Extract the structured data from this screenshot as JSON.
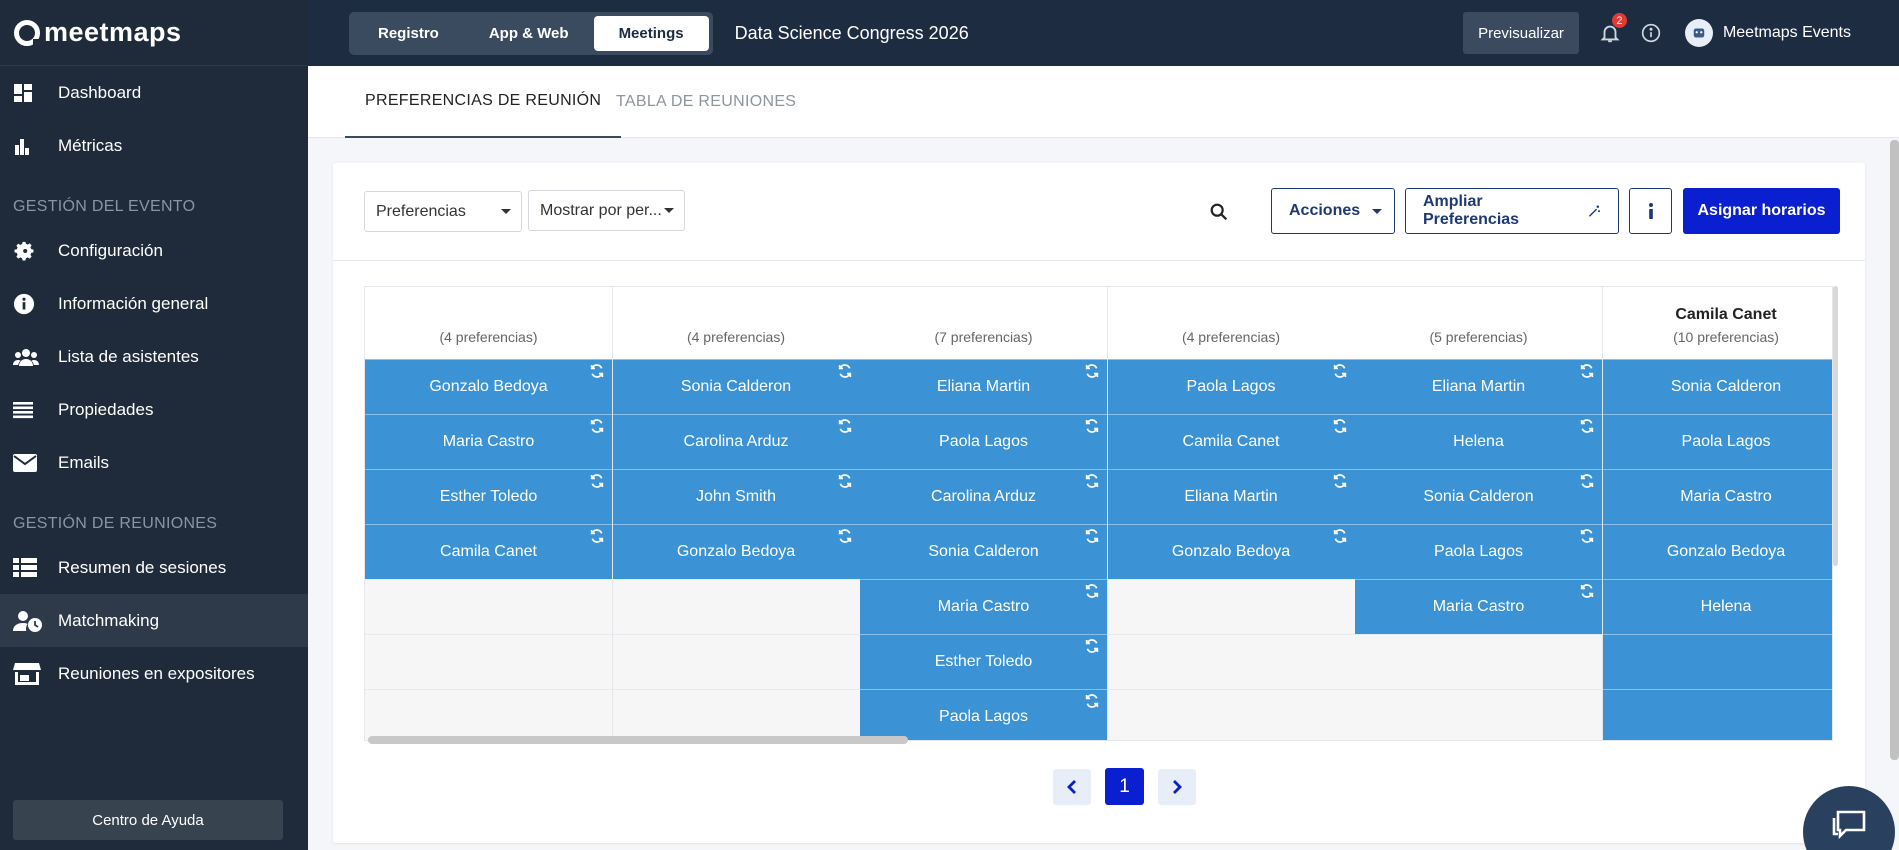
{
  "app": {
    "logo_text": "meetmaps"
  },
  "sidebar": {
    "items_top": [
      {
        "label": "Dashboard",
        "icon": "dashboard-icon"
      },
      {
        "label": "Métricas",
        "icon": "bar-chart-icon"
      }
    ],
    "section_event": "GESTIÓN DEL EVENTO",
    "items_event": [
      {
        "label": "Configuración",
        "icon": "gear-icon"
      },
      {
        "label": "Información general",
        "icon": "info-icon"
      },
      {
        "label": "Lista de asistentes",
        "icon": "users-icon"
      },
      {
        "label": "Propiedades",
        "icon": "list-icon"
      },
      {
        "label": "Emails",
        "icon": "mail-icon"
      }
    ],
    "section_meetings": "GESTIÓN DE REUNIONES",
    "items_meetings": [
      {
        "label": "Resumen de sesiones",
        "icon": "table-icon"
      },
      {
        "label": "Matchmaking",
        "icon": "user-clock-icon",
        "active": true
      },
      {
        "label": "Reuniones en expositores",
        "icon": "store-icon"
      }
    ],
    "help_label": "Centro de Ayuda"
  },
  "topbar": {
    "segments": [
      {
        "label": "Registro"
      },
      {
        "label": "App & Web"
      },
      {
        "label": "Meetings",
        "active": true
      }
    ],
    "event_title": "Data Science Congress 2026",
    "preview_label": "Previsualizar",
    "notification_count": "2",
    "user_name": "Meetmaps Events"
  },
  "tabs": [
    {
      "label": "PREFERENCIAS DE REUNIÓN",
      "active": true
    },
    {
      "label": "TABLA DE REUNIONES",
      "active": false
    }
  ],
  "toolbar": {
    "filter_select": "Preferencias",
    "view_select": "Mostrar por per...",
    "actions_label": "Acciones",
    "expand_label": "Ampliar Preferencias",
    "assign_label": "Asignar horarios"
  },
  "grid": {
    "columns": [
      {
        "name": "",
        "count": "(4 preferencias)",
        "cells": [
          "Gonzalo Bedoya",
          "Maria Castro",
          "Esther Toledo",
          "Camila Canet",
          "",
          "",
          ""
        ]
      },
      {
        "name": "",
        "count": "(4 preferencias)",
        "cells": [
          "Sonia Calderon",
          "Carolina Arduz",
          "John Smith",
          "Gonzalo Bedoya",
          "",
          "",
          ""
        ]
      },
      {
        "name": "",
        "count": "(7 preferencias)",
        "cells": [
          "Eliana Martin",
          "Paola Lagos",
          "Carolina Arduz",
          "Sonia Calderon",
          "Maria Castro",
          "Esther Toledo",
          "Paola Lagos"
        ]
      },
      {
        "name": "",
        "count": "(4 preferencias)",
        "cells": [
          "Paola Lagos",
          "Camila Canet",
          "Eliana Martin",
          "Gonzalo Bedoya",
          "",
          "",
          ""
        ]
      },
      {
        "name": "",
        "count": "(5 preferencias)",
        "cells": [
          "Eliana Martin",
          "Helena",
          "Sonia Calderon",
          "Paola Lagos",
          "Maria Castro",
          "",
          ""
        ]
      },
      {
        "name": "Camila Canet",
        "count": "(10 preferencias)",
        "cells": [
          "Sonia Calderon",
          "Paola Lagos",
          "Maria Castro",
          "Gonzalo Bedoya",
          "Helena",
          "",
          ""
        ],
        "extra_filled": 2
      }
    ]
  },
  "pagination": {
    "current": "1"
  },
  "colors": {
    "primary": "#0a1fd0",
    "cell_blue": "#3b93d6",
    "sidebar": "#1f2b3a",
    "topbar": "#1e2c42"
  }
}
